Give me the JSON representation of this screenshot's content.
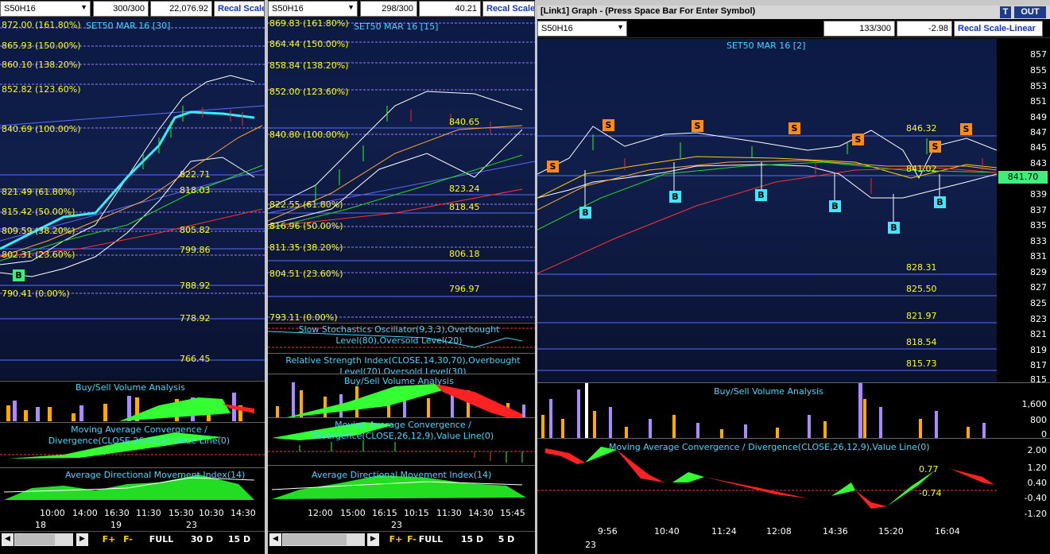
{
  "panel1": {
    "symbol": "S50H16",
    "bars": "300/300",
    "price": "22,076.92",
    "recal": "Recal Scale",
    "chart_title": "SET50 MAR 16  [30]",
    "fib": [
      "872.00 (161.80%)",
      "865.93 (150.00%)",
      "860.10 (138.20%)",
      "852.82 (123.60%)",
      "840.69 (100.00%)",
      "821.49 (61.80%)",
      "815.42 (50.00%)",
      "809.59 (38.20%)",
      "802.31 (23.60%)",
      "790.41 (0.00%)"
    ],
    "levels": [
      "822.71",
      "818.03",
      "805.82",
      "799.86",
      "788.92",
      "778.92",
      "766.45"
    ],
    "ind1": "Buy/Sell Volume Analysis",
    "ind2": "Moving Average Convergence / Divergence(CLOSE,26,12,9),Value Line(0)",
    "ind3": "Average Directional Movement Index(14)",
    "times": [
      "10:00",
      "14:00",
      "16:30",
      "11:30",
      "15:30",
      "10:30",
      "14:30"
    ],
    "dates": [
      "18",
      "19",
      "23"
    ],
    "btns": [
      "F+",
      "F-",
      "FULL",
      "30 D",
      "15 D"
    ]
  },
  "panel2": {
    "symbol": "S50H16",
    "bars": "298/300",
    "price": "40.21",
    "recal": "Recal Scale",
    "chart_title": "SET50 MAR 16  [15]",
    "fib": [
      "869.83 (161.80%)",
      "864.44 (150.00%)",
      "858.84 (138.20%)",
      "852.00 (123.60%)",
      "840.80 (100.00%)",
      "822.55 (61.80%)",
      "816.96 (50.00%)",
      "811.35 (38.20%)",
      "804.51 (23.60%)",
      "793.11 (0.00%)"
    ],
    "levels": [
      "840.65",
      "823.24",
      "818.45",
      "806.18",
      "796.97"
    ],
    "ind0": "Slow Stochastics Oscillator(9,3,3),Overbought Level(80),Oversold Level(20)",
    "ind0b": "Relative Strength Index(CLOSE,14,30,70),Overbought Level(70),Oversold Level(30)",
    "ind1": "Buy/Sell Volume Analysis",
    "ind2": "Moving Average Convergence / Divergence(CLOSE,26,12,9),Value Line(0)",
    "ind3": "Average Directional Movement Index(14)",
    "times": [
      "12:00",
      "15:00",
      "16:15",
      "10:15",
      "11:30",
      "14:30",
      "15:45"
    ],
    "dates": [
      "23"
    ],
    "btns": [
      "F+",
      "F-",
      "FULL",
      "15 D",
      "5 D"
    ]
  },
  "panel3": {
    "window_title": "[Link1] Graph  - (Press Space Bar For Enter Symbol)",
    "t_btn": "T",
    "out_btn": "OUT",
    "symbol": "S50H16",
    "bars": "133/300",
    "price": "-2.98",
    "recal": "Recal Scale-Linear",
    "chart_title": "SET50 MAR 16  [2]",
    "yticks": [
      "857",
      "855",
      "853",
      "851",
      "849",
      "847",
      "845",
      "843",
      "841",
      "839",
      "837",
      "835",
      "833",
      "831",
      "829",
      "827",
      "825",
      "823",
      "821",
      "819",
      "817",
      "815"
    ],
    "current_price": "841.70",
    "levels": [
      "846.32",
      "841.02",
      "828.31",
      "825.50",
      "821.97",
      "818.54",
      "815.73"
    ],
    "ind1": "Buy/Sell Volume Analysis",
    "vol_ticks": [
      "1,600",
      "800",
      "0"
    ],
    "ind2": "Moving Average Convergence / Divergence(CLOSE,26,12,9),Value Line(0)",
    "macd_vals": [
      "0.77",
      "-0.74"
    ],
    "macd_ticks": [
      "2.00",
      "1.20",
      "0.40",
      "-0.40",
      "-1.20"
    ],
    "times": [
      "9:56",
      "10:40",
      "11:24",
      "12:08",
      "14:36",
      "15:20",
      "16:04"
    ],
    "dates": [
      "23"
    ]
  },
  "colors": {
    "accent": "#42d7ff",
    "fib": "#ffff00",
    "bull": "#22ff22",
    "bear": "#ff2222",
    "sell": "#ff8c1a",
    "buy": "#3ee8ff"
  }
}
